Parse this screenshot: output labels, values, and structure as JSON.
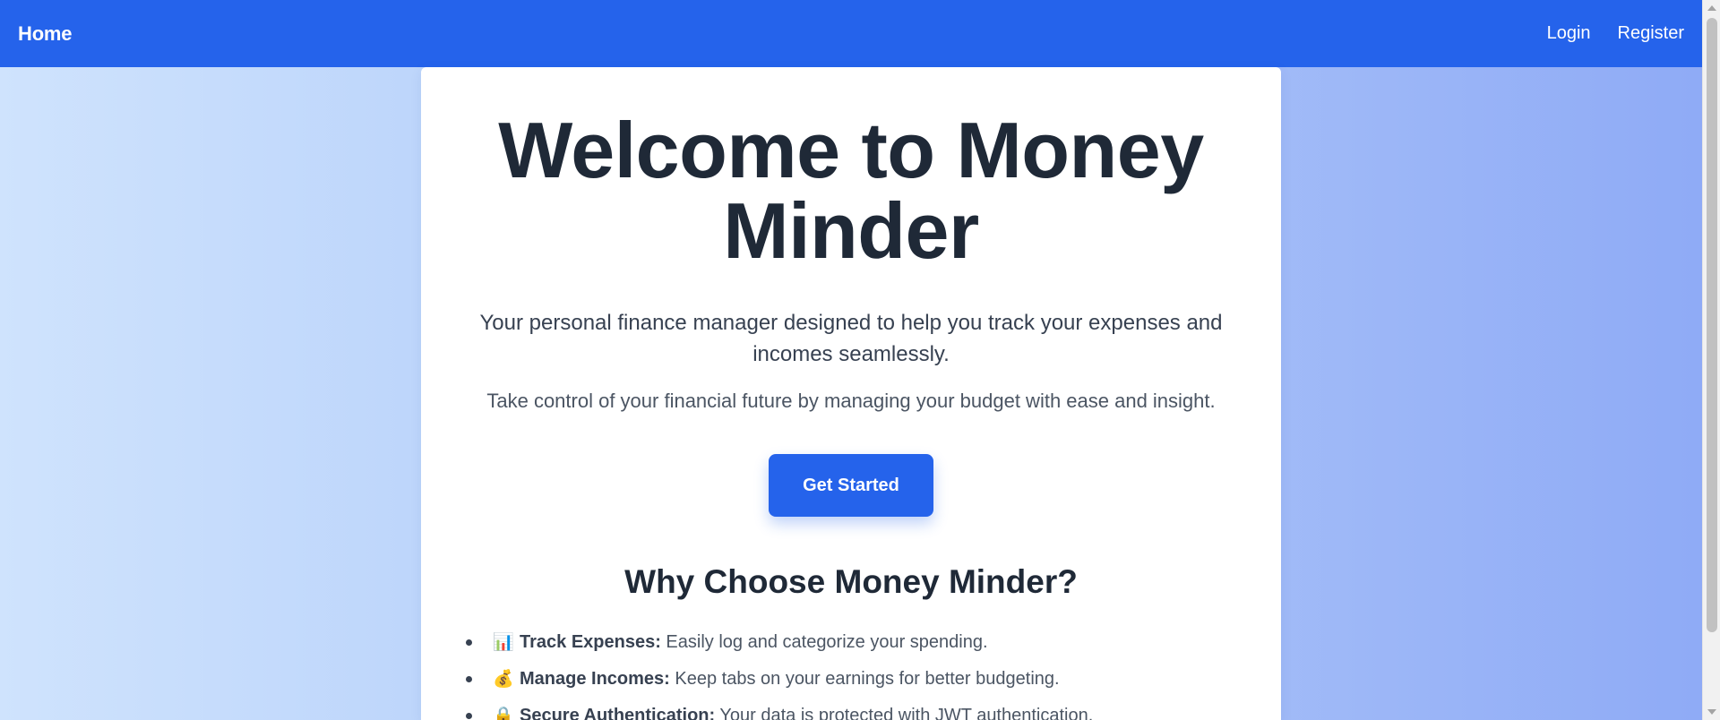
{
  "navbar": {
    "brand": "Home",
    "links": [
      "Login",
      "Register"
    ]
  },
  "hero": {
    "title_line1": "Welcome to Money",
    "title_line2": "Minder",
    "subtitle": "Your personal finance manager designed to help you track your expenses and incomes seamlessly.",
    "tagline": "Take control of your financial future by managing your budget with ease and insight.",
    "cta_label": "Get Started"
  },
  "features": {
    "heading": "Why Choose Money Minder?",
    "items": [
      {
        "icon": "📊",
        "icon_name": "bar-chart-icon",
        "title": "Track Expenses:",
        "text": " Easily log and categorize your spending."
      },
      {
        "icon": "💰",
        "icon_name": "money-bag-icon",
        "title": "Manage Incomes:",
        "text": " Keep tabs on your earnings for better budgeting."
      },
      {
        "icon": "🔒",
        "icon_name": "lock-icon",
        "title": "Secure Authentication:",
        "text": " Your data is protected with JWT authentication."
      }
    ]
  },
  "colors": {
    "navbar": "#2563eb",
    "button": "#2563eb",
    "heading": "#1f2937"
  }
}
